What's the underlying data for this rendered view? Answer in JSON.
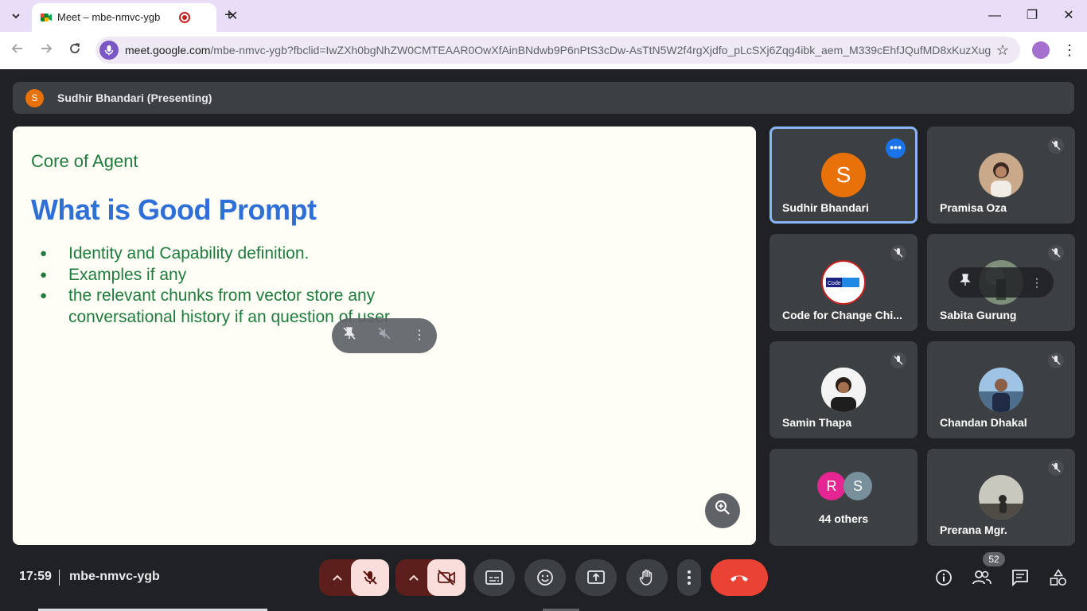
{
  "browser": {
    "tab": {
      "title": "Meet – mbe-nmvc-ygb",
      "close": "✕"
    },
    "new_tab": "+",
    "url_host": "meet.google.com",
    "url_path": "/mbe-nmvc-ygb?fbclid=IwZXh0bgNhZW0CMTEAAR0OwXfAinBNdwb9P6nPtS3cDw-AsTtN5W2f4rgXjdfo_pLcSXj6Zqg4ibk_aem_M339cEhfJQufMD8xKuzXug",
    "window_controls": [
      "—",
      "❐",
      "✕"
    ]
  },
  "meet": {
    "presenting": {
      "avatar_letter": "S",
      "label": "Sudhir Bhandari (Presenting)"
    },
    "slide": {
      "subtitle": "Core of Agent",
      "title": "What is Good Prompt",
      "bullets": [
        "Identity and Capability definition.",
        "Examples if any",
        "the relevant chunks from vector store any conversational history if an question of user"
      ]
    },
    "participants": [
      {
        "name": "Sudhir Bhandari",
        "avatar_letter": "S",
        "avatar_color": "#e8710a",
        "active_speaker": true
      },
      {
        "name": "Pramisa Oza",
        "muted": true
      },
      {
        "name": "Code for Change Chi...",
        "muted": true
      },
      {
        "name": "Sabita Gurung",
        "muted": true
      },
      {
        "name": "Samin Thapa",
        "muted": true
      },
      {
        "name": "Chandan Dhakal",
        "muted": true
      },
      {
        "name": "Prerana Mgr.",
        "muted": true
      }
    ],
    "others": {
      "letters": [
        "R",
        "S"
      ],
      "colors": [
        "#e52592",
        "#78909c"
      ],
      "label": "44 others"
    },
    "clock": "17:59",
    "meeting_code": "mbe-nmvc-ygb",
    "people_count": "52",
    "colors": {
      "end_call": "#ea4335",
      "active_border": "#8ab4f8",
      "slide_title": "#2f6fd8",
      "slide_text": "#1f7a3e"
    }
  }
}
